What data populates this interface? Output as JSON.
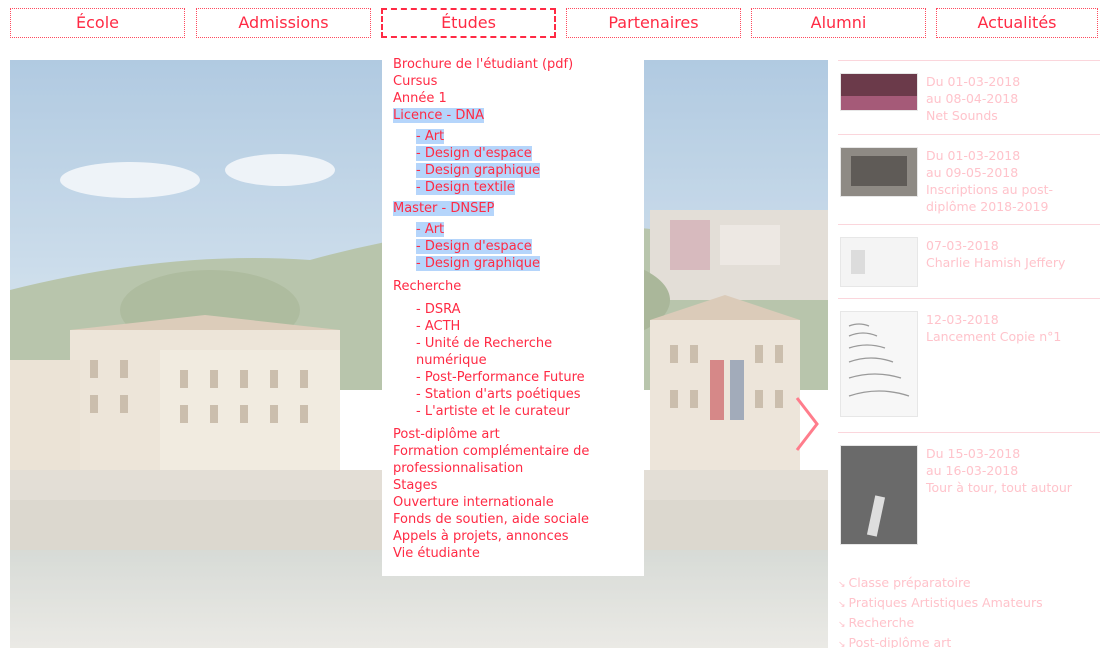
{
  "nav": {
    "items": [
      "École",
      "Admissions",
      "Études",
      "Partenaires",
      "Alumni",
      "Actualités"
    ],
    "active": "Études"
  },
  "menu": {
    "brochure": "Brochure de l'étudiant (pdf)",
    "cursus": "Cursus",
    "annee1": "Année 1",
    "licence": {
      "title": "Licence - DNA",
      "items": [
        "- Art",
        "- Design d'espace",
        "- Design graphique",
        "- Design textile"
      ]
    },
    "master": {
      "title": "Master - DNSEP",
      "items": [
        "- Art",
        "- Design d'espace",
        "- Design graphique"
      ]
    },
    "recherche": {
      "title": "Recherche",
      "items": [
        "- DSRA",
        "- ACTH",
        "- Unité de Recherche numérique",
        "- Post-Performance Future",
        "- Station d'arts poétiques",
        "- L'artiste et le curateur"
      ]
    },
    "bottom": [
      "Post-diplôme art",
      "Formation complémentaire de professionnalisation",
      "Stages",
      "Ouverture internationale",
      "Fonds de soutien, aide sociale",
      "Appels à projets, annonces",
      "Vie étudiante"
    ]
  },
  "news": [
    {
      "line1": "Du 01-03-2018",
      "line2": "au 08-04-2018",
      "line3": "Net Sounds"
    },
    {
      "line1": "Du 01-03-2018",
      "line2": "au 09-05-2018",
      "line3": "Inscriptions au post-diplôme 2018-2019"
    },
    {
      "line1": "07-03-2018",
      "line2": "Charlie Hamish Jeffery",
      "line3": ""
    },
    {
      "line1": "12-03-2018",
      "line2": "Lancement Copie n°1",
      "line3": ""
    },
    {
      "line1": "Du 15-03-2018",
      "line2": "au 16-03-2018",
      "line3": "Tour à tour, tout autour"
    }
  ],
  "links": [
    "Classe préparatoire",
    "Pratiques Artistiques Amateurs",
    "Recherche",
    "Post-diplôme art"
  ],
  "colors": {
    "accent": "#ff2a44",
    "highlight": "#b5d5fb",
    "faded": "#ffc3cb"
  },
  "icons": {
    "carousel_next": "chevron-right-icon",
    "link_marker": "arrow-down-right-icon"
  }
}
